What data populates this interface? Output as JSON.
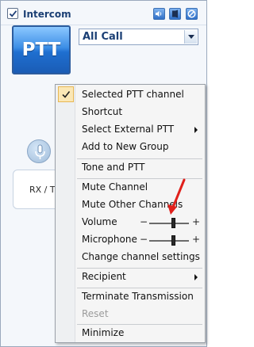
{
  "panel": {
    "title": "Intercom",
    "enabled": true,
    "ptt_label": "PTT",
    "channel_value": "All Call",
    "rxtx_label": "RX / TX",
    "icons": {
      "check": "checkmark-icon",
      "speaker": "speaker-icon",
      "mute": "mute-icon",
      "block": "block-icon",
      "dropdown": "chevron-down-icon",
      "mic": "microphone-icon"
    }
  },
  "menu": {
    "selected_ptt_channel": "Selected PTT channel",
    "shortcut": "Shortcut",
    "select_external_ptt": "Select External PTT",
    "add_to_new_group": "Add to New Group",
    "tone_and_ptt": "Tone and PTT",
    "mute_channel": "Mute Channel",
    "mute_other_channels": "Mute Other Channels",
    "volume": "Volume",
    "microphone": "Microphone",
    "change_channel_settings": "Change channel settings",
    "recipient": "Recipient",
    "terminate_transmission": "Terminate Transmission",
    "reset": "Reset",
    "minimize": "Minimize",
    "slider_minus": "−",
    "slider_plus": "+",
    "volume_level": 0.62,
    "microphone_level": 0.62,
    "checked_item": "Selected PTT channel",
    "disabled_items": [
      "Reset"
    ]
  },
  "colors": {
    "accent": "#2f6fc7",
    "check_highlight": "#fbe7b5",
    "annotation": "#e0201b"
  }
}
